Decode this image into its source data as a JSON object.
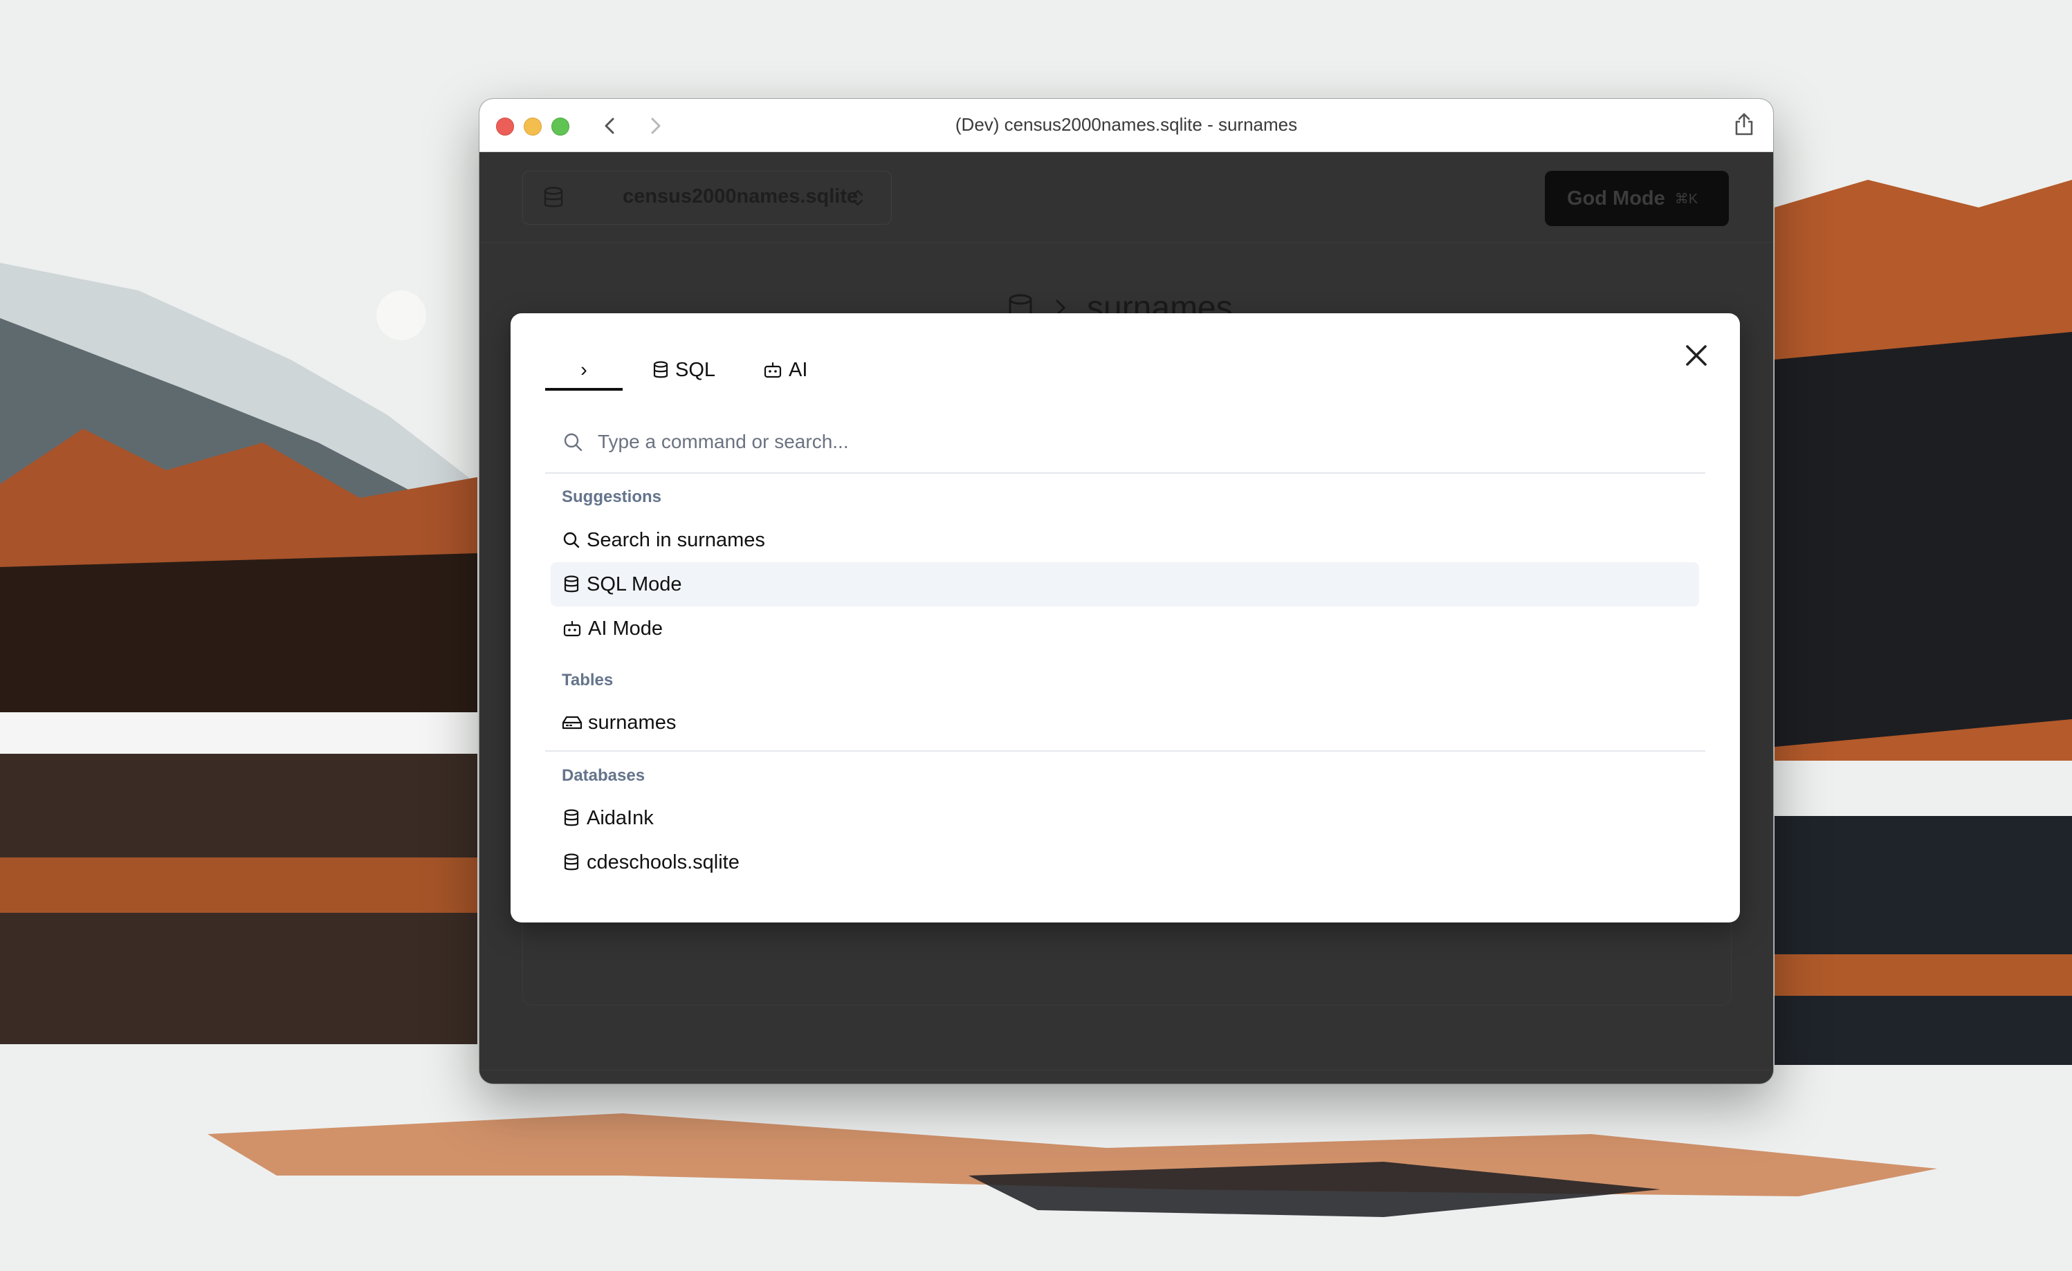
{
  "window": {
    "title": "(Dev) census2000names.sqlite - surnames"
  },
  "app": {
    "db_selector": "census2000names.sqlite",
    "god_mode_label": "God Mode",
    "god_mode_shortcut": "⌘K",
    "bg_heading_title": "surnames"
  },
  "palette": {
    "tabs": [
      {
        "label": "›"
      },
      {
        "label": "SQL"
      },
      {
        "label": "AI"
      }
    ],
    "search_placeholder": "Type a command or search...",
    "sections": {
      "suggestions": "Suggestions",
      "tables": "Tables",
      "databases": "Databases"
    },
    "suggestions": [
      {
        "label": "Search in surnames",
        "icon": "search-icon"
      },
      {
        "label": "SQL Mode",
        "icon": "database-icon",
        "selected": true
      },
      {
        "label": "AI Mode",
        "icon": "bot-icon"
      }
    ],
    "tables": [
      {
        "label": "surnames",
        "icon": "table-drive-icon"
      }
    ],
    "databases": [
      {
        "label": "AidaInk",
        "icon": "database-icon"
      },
      {
        "label": "cdeschools.sqlite",
        "icon": "database-icon"
      }
    ]
  },
  "colors": {
    "selected_row_bg": "#f1f4f8",
    "app_bg": "#333333",
    "accent_dark": "#0d0d0d"
  }
}
